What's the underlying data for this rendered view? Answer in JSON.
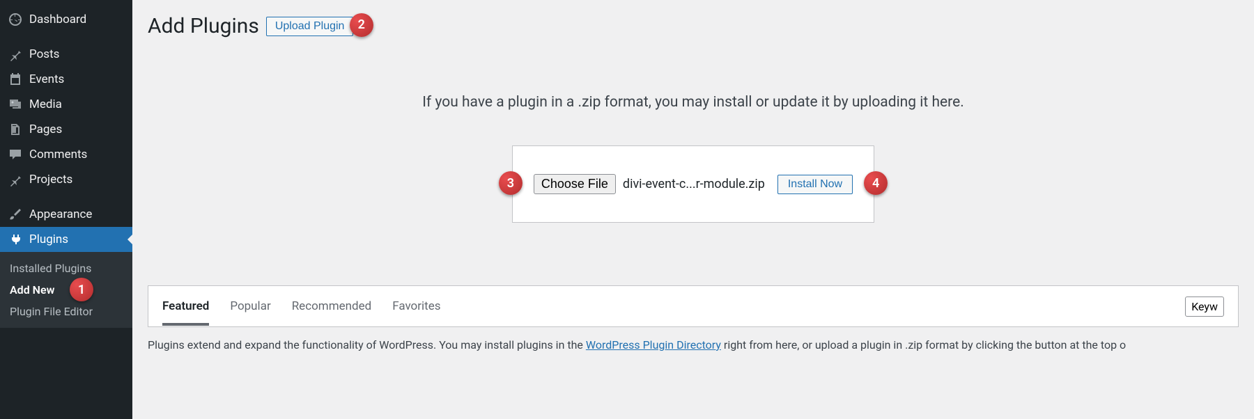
{
  "sidebar": {
    "items": [
      {
        "label": "Dashboard",
        "icon": "dashboard"
      },
      {
        "label": "Posts",
        "icon": "pin"
      },
      {
        "label": "Events",
        "icon": "calendar"
      },
      {
        "label": "Media",
        "icon": "media"
      },
      {
        "label": "Pages",
        "icon": "pages"
      },
      {
        "label": "Comments",
        "icon": "comments"
      },
      {
        "label": "Projects",
        "icon": "pin"
      },
      {
        "label": "Appearance",
        "icon": "brush"
      },
      {
        "label": "Plugins",
        "icon": "plug"
      }
    ],
    "submenu": [
      {
        "label": "Installed Plugins"
      },
      {
        "label": "Add New"
      },
      {
        "label": "Plugin File Editor"
      }
    ]
  },
  "page": {
    "title": "Add Plugins",
    "upload_button": "Upload Plugin",
    "upload_message": "If you have a plugin in a .zip format, you may install or update it by uploading it here.",
    "choose_file": "Choose File",
    "file_name": "divi-event-c...r-module.zip",
    "install_now": "Install Now",
    "tabs": [
      {
        "label": "Featured"
      },
      {
        "label": "Popular"
      },
      {
        "label": "Recommended"
      },
      {
        "label": "Favorites"
      }
    ],
    "search_label": "Keyw",
    "description_prefix": "Plugins extend and expand the functionality of WordPress. You may install plugins in the ",
    "description_link": "WordPress Plugin Directory",
    "description_suffix": " right from here, or upload a plugin in .zip format by clicking the button at the top o"
  },
  "badges": {
    "b1": "1",
    "b2": "2",
    "b3": "3",
    "b4": "4"
  }
}
